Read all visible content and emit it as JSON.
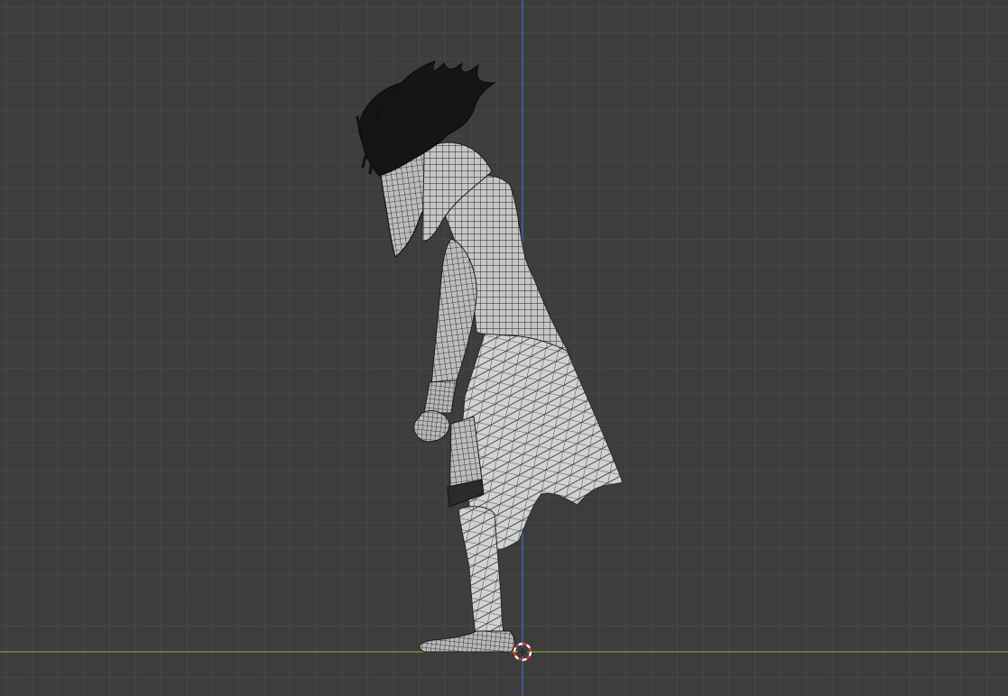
{
  "viewport": {
    "view": "right-orthographic",
    "shading": "wireframe-solid",
    "colors": {
      "background": "#3d3d3d",
      "grid_minor": "#353535",
      "grid_major": "#474747",
      "axis_x": "#7a9e2c",
      "axis_z": "#3b6fb3",
      "mesh_fill": "#c9c9c9",
      "mesh_wire": "#1c1c1c",
      "hair": "#151515",
      "cursor_red": "#d8382e",
      "cursor_white": "#ffffff"
    },
    "object": {
      "name_icon": "character-mesh-icon",
      "parts": [
        "hair",
        "scarf",
        "coat",
        "arm",
        "fist",
        "leg",
        "foot"
      ]
    },
    "cursor_icon": "3d-cursor-icon"
  }
}
